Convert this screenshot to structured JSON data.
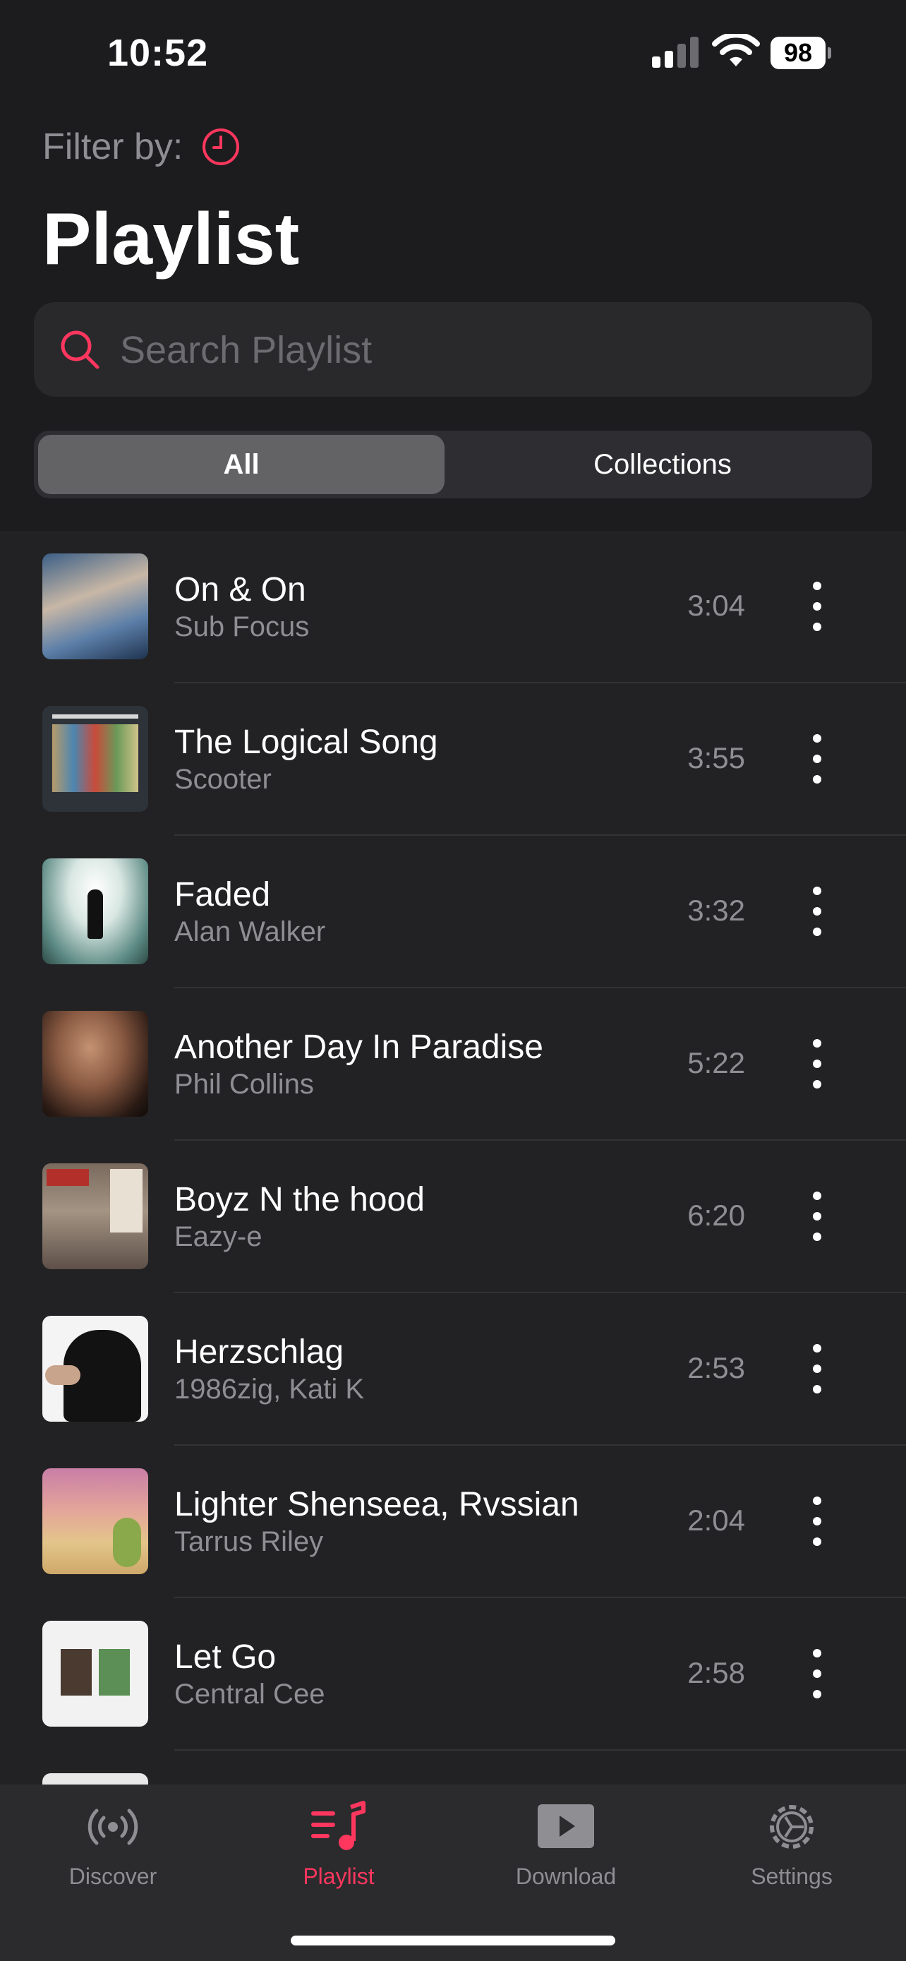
{
  "status_bar": {
    "time": "10:52",
    "battery": "98"
  },
  "header": {
    "filter_label": "Filter by:",
    "title": "Playlist"
  },
  "search": {
    "placeholder": "Search Playlist"
  },
  "segments": {
    "all": "All",
    "collections": "Collections",
    "selected": "All"
  },
  "colors": {
    "accent": "#ff375f",
    "background": "#1c1c1e",
    "secondary_text": "#8e8e93"
  },
  "songs": [
    {
      "title": "On & On",
      "artist": "Sub Focus",
      "duration": "3:04"
    },
    {
      "title": "The Logical Song",
      "artist": "Scooter",
      "duration": "3:55"
    },
    {
      "title": "Faded",
      "artist": "Alan Walker",
      "duration": "3:32"
    },
    {
      "title": "Another Day In Paradise",
      "artist": "Phil Collins",
      "duration": "5:22"
    },
    {
      "title": "Boyz N the hood",
      "artist": "Eazy-e",
      "duration": "6:20"
    },
    {
      "title": "Herzschlag",
      "artist": "1986zig, Kati K",
      "duration": "2:53"
    },
    {
      "title": "Lighter Shenseea, Rvssian",
      "artist": "Tarrus Riley",
      "duration": "2:04"
    },
    {
      "title": "Let Go",
      "artist": "Central Cee",
      "duration": "2:58"
    }
  ],
  "tabs": [
    {
      "label": "Discover",
      "icon": "broadcast-icon"
    },
    {
      "label": "Playlist",
      "icon": "music-list-icon",
      "active": true
    },
    {
      "label": "Download",
      "icon": "play-box-icon"
    },
    {
      "label": "Settings",
      "icon": "gear-icon"
    }
  ]
}
